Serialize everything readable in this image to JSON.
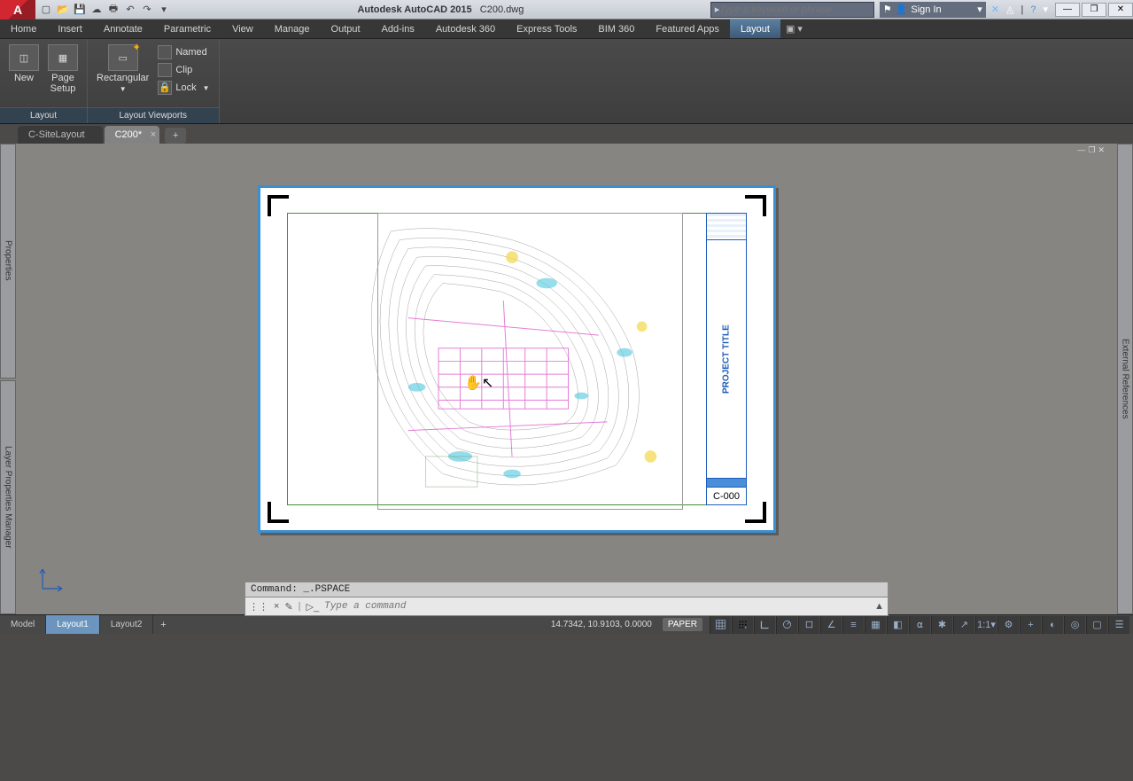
{
  "title": {
    "app": "Autodesk AutoCAD 2015",
    "file": "C200.dwg"
  },
  "search": {
    "placeholder": "Type a keyword or phrase"
  },
  "signin": {
    "label": "Sign In"
  },
  "menu": [
    "Home",
    "Insert",
    "Annotate",
    "Parametric",
    "View",
    "Manage",
    "Output",
    "Add-ins",
    "Autodesk 360",
    "Express Tools",
    "BIM 360",
    "Featured Apps",
    "Layout"
  ],
  "menu_active": "Layout",
  "ribbon": {
    "panel1": {
      "title": "Layout",
      "new": "New",
      "pagesetup": "Page\nSetup"
    },
    "panel2": {
      "title": "Layout Viewports",
      "rect": "Rectangular",
      "named": "Named",
      "clip": "Clip",
      "lock": "Lock"
    }
  },
  "doctabs": [
    {
      "label": "C-SiteLayout",
      "active": false
    },
    {
      "label": "C200*",
      "active": true
    }
  ],
  "left_panels": [
    "Properties",
    "Layer Properties Manager"
  ],
  "right_panel": "External References",
  "title_block": {
    "project": "PROJECT TITLE",
    "sheet": "C-000"
  },
  "command": {
    "hist": "Command: _.PSPACE",
    "placeholder": "Type a command"
  },
  "model_tabs": [
    {
      "label": "Model",
      "active": false
    },
    {
      "label": "Layout1",
      "active": true
    },
    {
      "label": "Layout2",
      "active": false
    }
  ],
  "status": {
    "coords": "14.7342, 10.9103, 0.0000",
    "space": "PAPER"
  }
}
